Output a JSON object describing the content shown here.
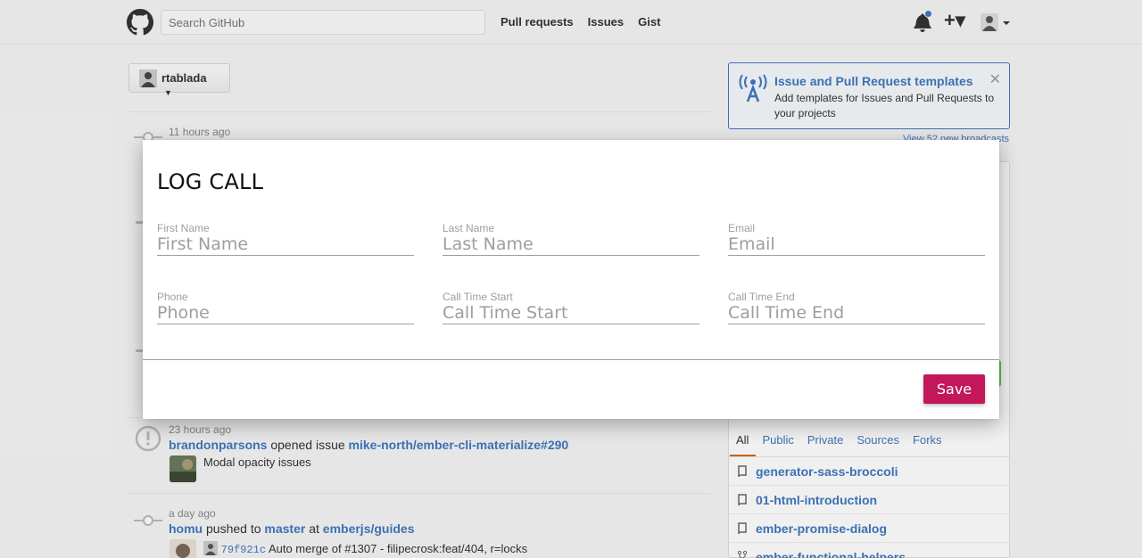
{
  "header": {
    "search_placeholder": "Search GitHub",
    "nav": [
      "Pull requests",
      "Issues",
      "Gist"
    ],
    "plus_caret": "+▾"
  },
  "context_switcher": {
    "user": "rtablada"
  },
  "broadcast": {
    "title": "Issue and Pull Request templates",
    "body": "Add templates for Issues and Pull Requests to your projects",
    "close": "✕",
    "view_more": "View 52 new broadcasts"
  },
  "feed": [
    {
      "time": "11 hours ago"
    },
    {
      "time": "23 hours ago",
      "actor": "brandonparsons",
      "action": "opened issue",
      "target": "mike-north/ember-cli-materialize#290",
      "detail": "Modal opacity issues"
    },
    {
      "time": "a day ago",
      "actor": "homu",
      "action": "pushed to",
      "branch": "master",
      "at": "at",
      "repo": "emberjs/guides",
      "sha": "79f921c",
      "commit_msg": "Auto merge of #1307 - filipecrosk:feat/404, r=locks"
    }
  ],
  "repos": {
    "tabs": [
      "All",
      "Public",
      "Private",
      "Sources",
      "Forks"
    ],
    "items": [
      "generator-sass-broccoli",
      "01-html-introduction",
      "ember-promise-dialog",
      "ember-functional-helpers"
    ]
  },
  "dialog": {
    "title": "LOG CALL",
    "fields": [
      {
        "label": "First Name",
        "placeholder": "First Name"
      },
      {
        "label": "Last Name",
        "placeholder": "Last Name"
      },
      {
        "label": "Email",
        "placeholder": "Email"
      },
      {
        "label": "Phone",
        "placeholder": "Phone"
      },
      {
        "label": "Call Time Start",
        "placeholder": "Call Time Start"
      },
      {
        "label": "Call Time End",
        "placeholder": "Call Time End"
      }
    ],
    "save_label": "Save"
  },
  "colors": {
    "accent": "#c2185b",
    "link": "#4078c0"
  }
}
